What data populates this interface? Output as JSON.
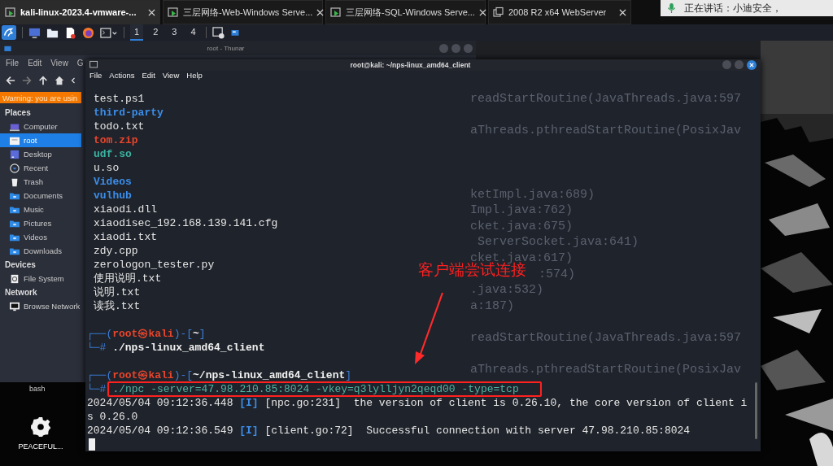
{
  "vm_tabs": [
    {
      "label": "kali-linux-2023.4-vmware-...",
      "selected": true,
      "kind": "vm"
    },
    {
      "label": "三层网络-Web-Windows Serve...",
      "selected": false,
      "kind": "vm"
    },
    {
      "label": "三层网络-SQL-Windows Serve...",
      "selected": false,
      "kind": "vm"
    },
    {
      "label": "2008 R2 x64 WebServer",
      "selected": false,
      "kind": "clone"
    }
  ],
  "notification": {
    "text": "正在讲话：小迪安全，"
  },
  "panel": {
    "workspaces": [
      {
        "label": "1",
        "selected": true
      },
      {
        "label": "2",
        "selected": false
      },
      {
        "label": "3",
        "selected": false
      },
      {
        "label": "4",
        "selected": false
      }
    ]
  },
  "thunar": {
    "title": "root - Thunar",
    "menu": [
      "File",
      "Edit",
      "View",
      "G"
    ],
    "warning": "Warning: you are usin",
    "sections": [
      {
        "title": "Places",
        "items": [
          {
            "label": "Computer",
            "kind": "computer",
            "selected": false
          },
          {
            "label": "root",
            "kind": "home",
            "selected": true
          },
          {
            "label": "Desktop",
            "kind": "desktop",
            "selected": false
          },
          {
            "label": "Recent",
            "kind": "recent",
            "selected": false
          },
          {
            "label": "Trash",
            "kind": "trash",
            "selected": false
          },
          {
            "label": "Documents",
            "kind": "folder",
            "selected": false
          },
          {
            "label": "Music",
            "kind": "folder",
            "selected": false
          },
          {
            "label": "Pictures",
            "kind": "folder",
            "selected": false
          },
          {
            "label": "Videos",
            "kind": "folder",
            "selected": false
          },
          {
            "label": "Downloads",
            "kind": "folder",
            "selected": false
          }
        ]
      },
      {
        "title": "Devices",
        "items": [
          {
            "label": "File System",
            "kind": "drive",
            "selected": false
          }
        ]
      },
      {
        "title": "Network",
        "items": [
          {
            "label": "Browse Network",
            "kind": "network",
            "selected": false
          }
        ]
      }
    ]
  },
  "terminal": {
    "title": "root@kali: ~/nps-linux_amd64_client",
    "menu": [
      "File",
      "Actions",
      "Edit",
      "View",
      "Help"
    ],
    "cursor": true,
    "blocks": [
      {
        "lines": [
          {
            "segments": [
              {
                "kind": "text",
                "text": "test.ps1"
              }
            ]
          },
          {
            "segments": [
              {
                "kind": "dir",
                "text": "third-party"
              }
            ]
          },
          {
            "segments": [
              {
                "kind": "text",
                "text": "todo.txt"
              }
            ]
          },
          {
            "segments": [
              {
                "kind": "archive",
                "text": "tom.zip"
              }
            ]
          },
          {
            "segments": [
              {
                "kind": "lib",
                "text": "udf.so"
              }
            ]
          },
          {
            "segments": [
              {
                "kind": "text",
                "text": "u.so"
              }
            ]
          },
          {
            "segments": [
              {
                "kind": "dir",
                "text": "Videos"
              }
            ]
          },
          {
            "segments": [
              {
                "kind": "dir",
                "text": "vulhub"
              }
            ]
          },
          {
            "segments": [
              {
                "kind": "text",
                "text": "xiaodi.dll"
              }
            ]
          },
          {
            "segments": [
              {
                "kind": "text",
                "text": "xiaodisec_192.168.139.141.cfg"
              }
            ]
          },
          {
            "segments": [
              {
                "kind": "text",
                "text": "xiaodi.txt"
              }
            ]
          },
          {
            "segments": [
              {
                "kind": "text",
                "text": "zdy.cpp"
              }
            ]
          },
          {
            "segments": [
              {
                "kind": "text",
                "text": "zerologon_tester.py"
              }
            ]
          },
          {
            "segments": [
              {
                "kind": "text",
                "text": "使用说明.txt"
              }
            ]
          },
          {
            "segments": [
              {
                "kind": "text",
                "text": "说明.txt"
              }
            ]
          },
          {
            "segments": [
              {
                "kind": "text",
                "text": "读我.txt"
              }
            ]
          }
        ]
      },
      {
        "lines": [
          {
            "segments": [
              {
                "kind": "frame",
                "text": "┌──("
              },
              {
                "kind": "user",
                "text": "root㉿kali"
              },
              {
                "kind": "frame",
                "text": ")-["
              },
              {
                "kind": "path",
                "text": "~"
              },
              {
                "kind": "frame",
                "text": "]"
              }
            ]
          },
          {
            "segments": [
              {
                "kind": "frame",
                "text": "└─#"
              },
              {
                "kind": "command",
                "text": " ./nps-linux_amd64_client"
              }
            ]
          }
        ]
      },
      {
        "lines": [
          {
            "segments": [
              {
                "kind": "frame",
                "text": "┌──("
              },
              {
                "kind": "user",
                "text": "root㉿kali"
              },
              {
                "kind": "frame",
                "text": ")-["
              },
              {
                "kind": "path",
                "text": "~/nps-linux_amd64_client"
              },
              {
                "kind": "frame",
                "text": "]"
              }
            ]
          },
          {
            "segments": [
              {
                "kind": "frame",
                "text": "└─#"
              },
              {
                "kind": "highlighted",
                "text": "./npc -server=47.98.210.85:8024 -vkey=q3lylljyn2qeqd00 -type=tcp"
              }
            ]
          },
          {
            "segments": [
              {
                "kind": "text",
                "text": "2024/05/04 09:12:36.448 "
              },
              {
                "kind": "tag",
                "text": "[I]"
              },
              {
                "kind": "text",
                "text": " [npc.go:231]  the version of client is 0.26.10, the core version of client i"
              }
            ]
          },
          {
            "segments": [
              {
                "kind": "text",
                "text": "s 0.26.0"
              }
            ]
          },
          {
            "segments": [
              {
                "kind": "text",
                "text": "2024/05/04 09:12:36.549 "
              },
              {
                "kind": "tag",
                "text": "[I]"
              },
              {
                "kind": "text",
                "text": " [client.go:72]  Successful connection with server 47.98.210.85:8024"
              }
            ]
          }
        ]
      }
    ],
    "background_groups": [
      {
        "lines": [
          "readStartRoutine(JavaThreads.java:597"
        ]
      },
      {
        "lines": [
          "aThreads.pthreadStartRoutine(PosixJav"
        ]
      },
      {
        "lines": [
          "ketImpl.java:689)",
          "Impl.java:762)",
          "cket.java:675)",
          " ServerSocket.java:641)",
          "cket.java:617)",
          ":574)",
          ".java:532)",
          "a:187)"
        ]
      },
      {
        "lines": [
          "readStartRoutine(JavaThreads.java:597"
        ]
      },
      {
        "lines": [
          "aThreads.pthreadStartRoutine(PosixJav"
        ]
      }
    ]
  },
  "desktop": {
    "window_label": "bash",
    "icons": [
      {
        "label": "PEACEFUL..."
      }
    ]
  },
  "annotation": {
    "text": "客户端尝试连接"
  }
}
